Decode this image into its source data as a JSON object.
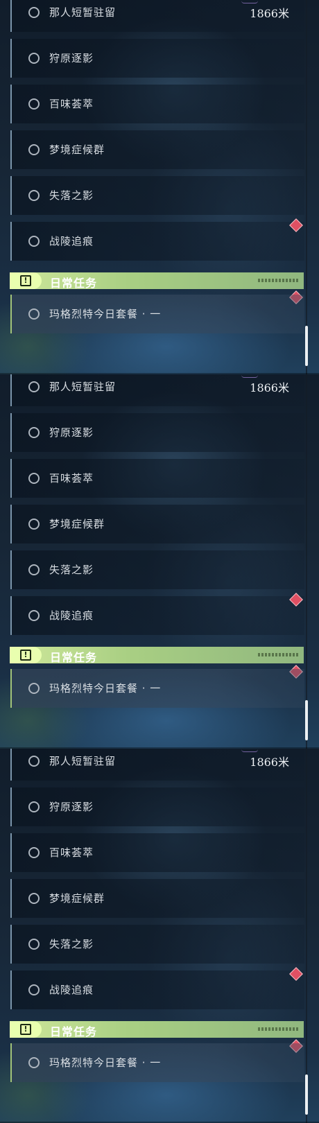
{
  "panels": [
    {
      "rows": [
        {
          "label": "那人短暂驻留",
          "distance": "1866米"
        },
        {
          "label": "狩原逐影"
        },
        {
          "label": "百味荟萃"
        },
        {
          "label": "梦境症候群"
        },
        {
          "label": "失落之影"
        },
        {
          "label": "战陵追痕"
        }
      ],
      "section": {
        "icon": "!",
        "title": "日常任务"
      },
      "daily": [
        {
          "label": "玛格烈特今日套餐 · 一"
        }
      ]
    },
    {
      "rows": [
        {
          "label": "那人短暂驻留",
          "distance": "1866米"
        },
        {
          "label": "狩原逐影"
        },
        {
          "label": "百味荟萃"
        },
        {
          "label": "梦境症候群"
        },
        {
          "label": "失落之影"
        },
        {
          "label": "战陵追痕"
        }
      ],
      "section": {
        "icon": "!",
        "title": "日常任务"
      },
      "daily": [
        {
          "label": "玛格烈特今日套餐 · 一"
        }
      ]
    },
    {
      "rows": [
        {
          "label": "那人短暂驻留",
          "distance": "1866米"
        },
        {
          "label": "狩原逐影"
        },
        {
          "label": "百味荟萃"
        },
        {
          "label": "梦境症候群"
        },
        {
          "label": "失落之影"
        },
        {
          "label": "战陵追痕"
        }
      ],
      "section": {
        "icon": "!",
        "title": "日常任务"
      },
      "daily": [
        {
          "label": "玛格烈特今日套餐 · 一"
        }
      ]
    }
  ],
  "icons": {
    "quest_status": "circle-outline-icon",
    "section_icon": "exclamation-square-icon",
    "marker": "diamond-marker-icon"
  },
  "colors": {
    "section_accent": "#cfe89b",
    "daily_accent": "#a2c47a",
    "marker": "#e05063"
  }
}
